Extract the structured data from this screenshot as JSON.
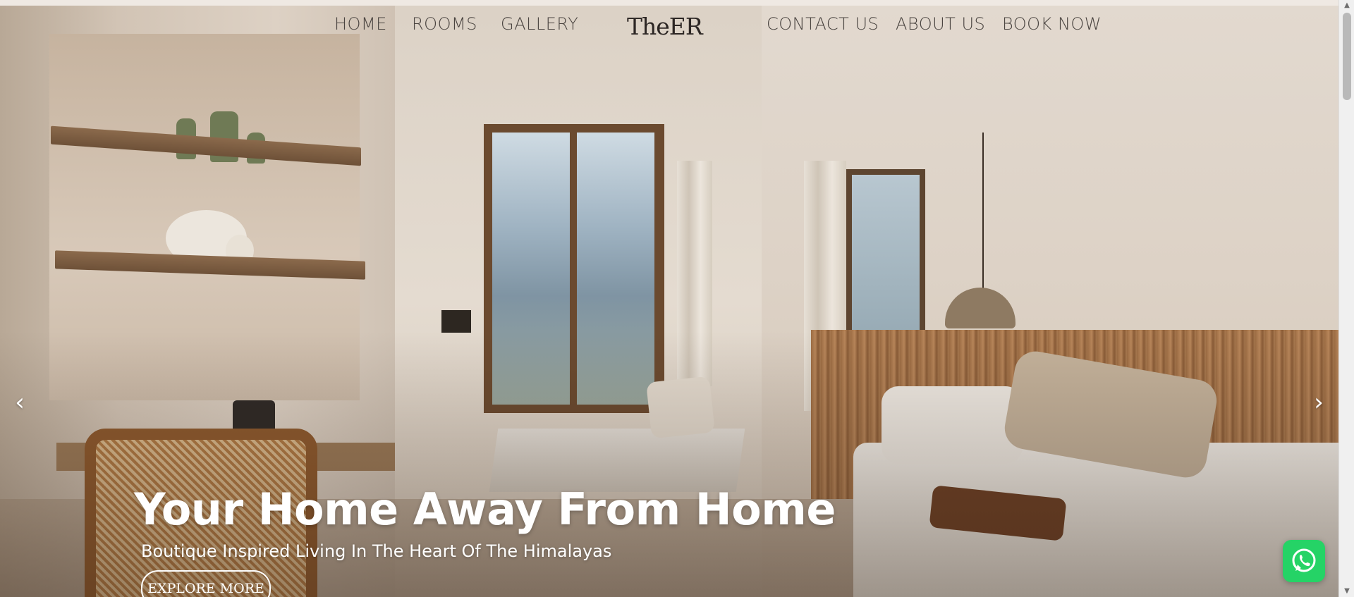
{
  "nav": {
    "home": "HOME",
    "rooms": "ROOMS",
    "gallery": "GALLERY",
    "contact": "CONTACT US",
    "about": "ABOUT US",
    "book": "BOOK NOW"
  },
  "brand": {
    "logo_text": "TheER"
  },
  "hero": {
    "title": "Your Home Away From Home",
    "subtitle": "Boutique Inspired Living In The Heart Of The Himalayas",
    "cta_label": "EXPLORE MORE"
  },
  "slider": {
    "prev_icon": "‹",
    "next_icon": "›"
  },
  "scrollbar": {
    "up_icon": "▲",
    "down_icon": "▼"
  },
  "widgets": {
    "whatsapp_icon": "whatsapp-icon"
  },
  "colors": {
    "whatsapp_green": "#25d366",
    "nav_text": "#4a4440",
    "hero_text": "#ffffff"
  }
}
